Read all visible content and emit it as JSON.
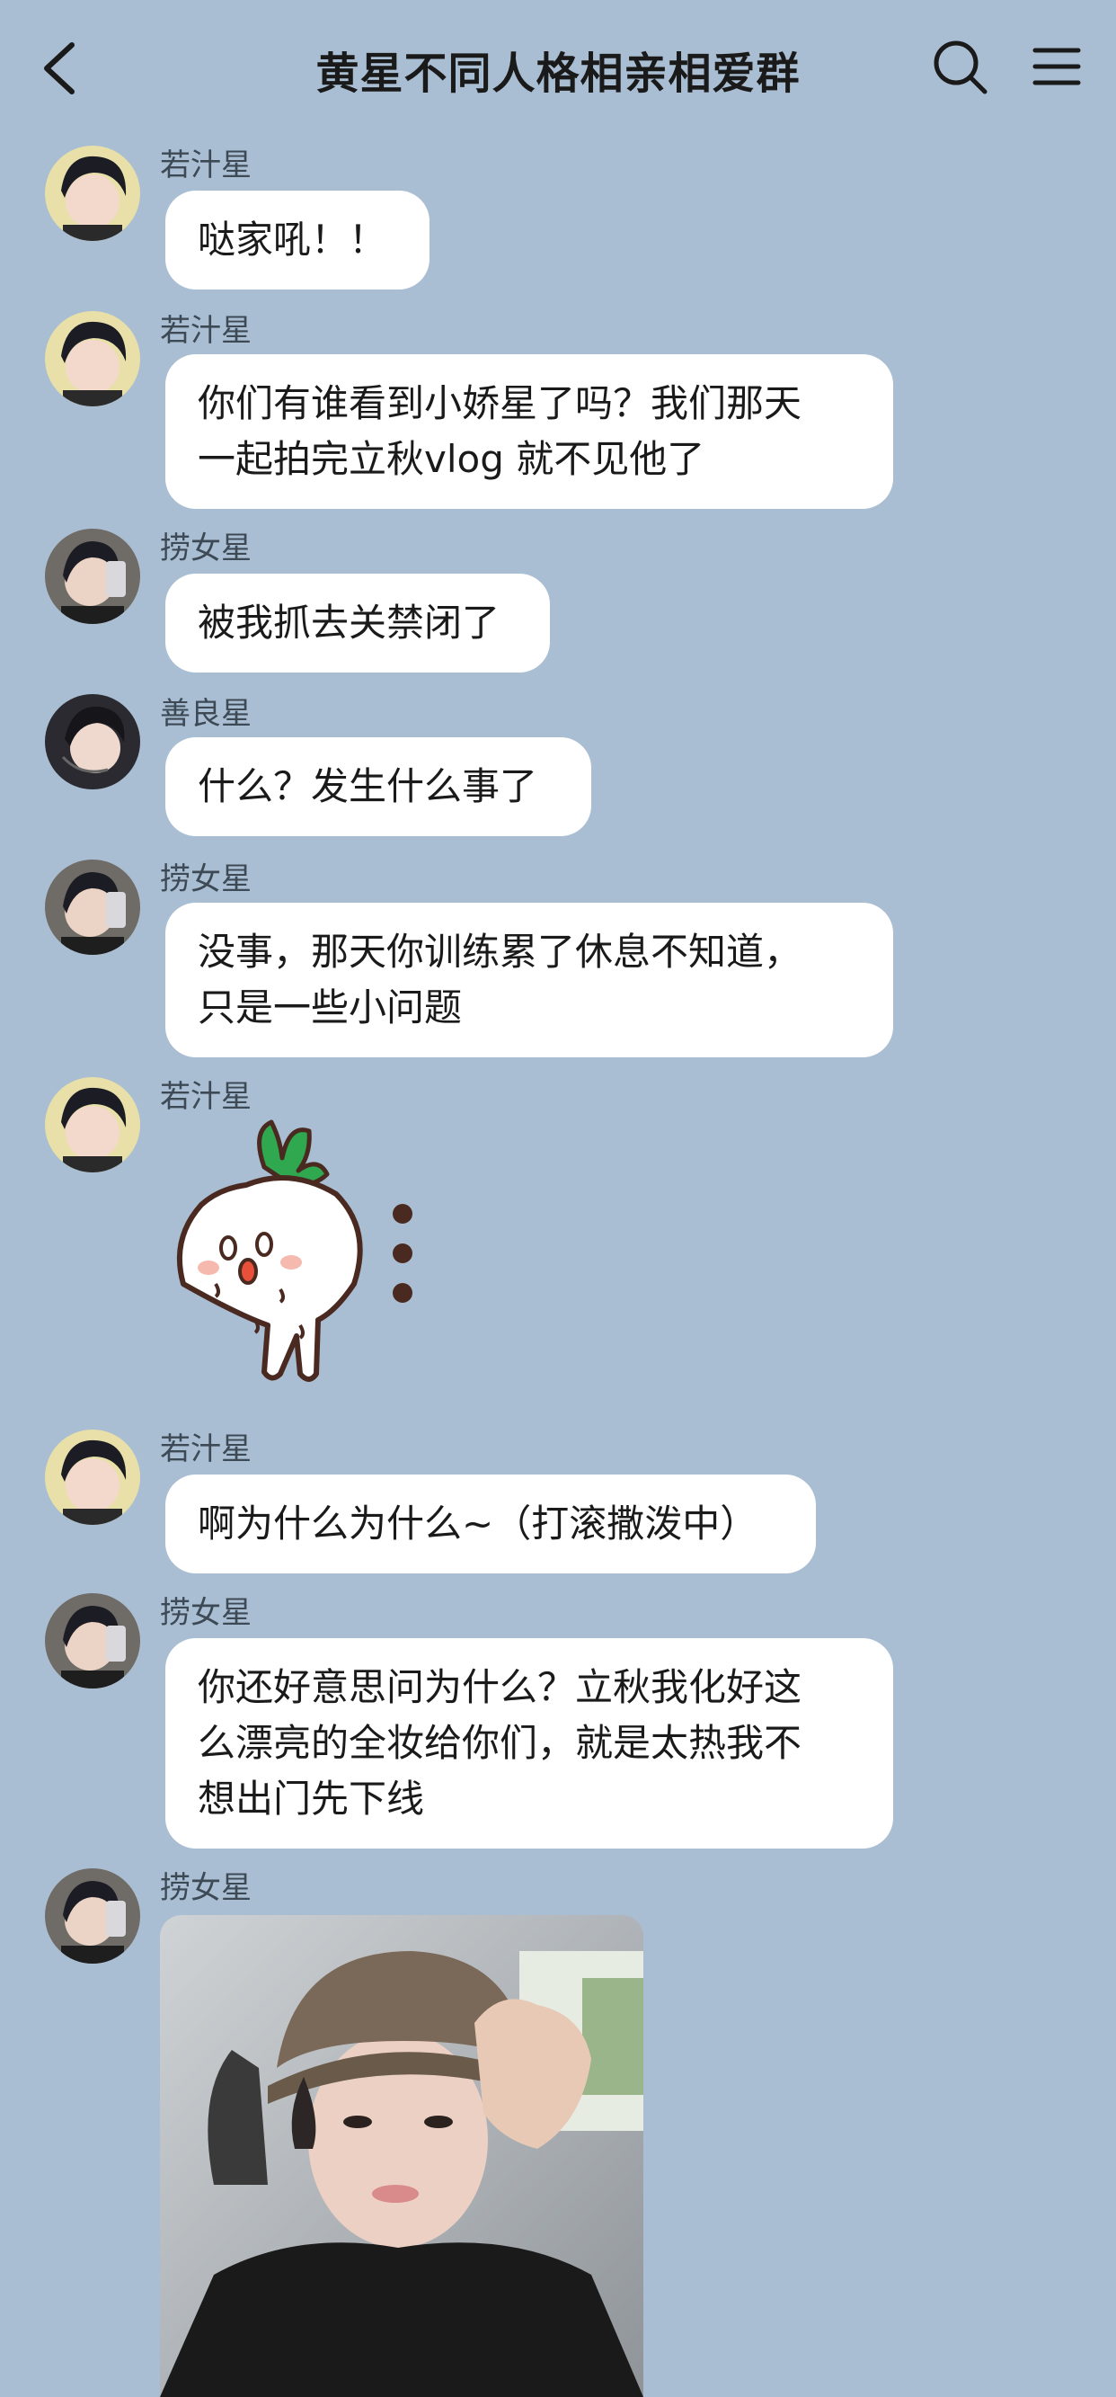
{
  "header": {
    "title": "黄星不同人格相亲相爱群",
    "back_icon": "chevron-left-icon",
    "search_icon": "search-icon",
    "menu_icon": "hamburger-menu-icon"
  },
  "messages": [
    {
      "sender": "若汁星",
      "lines": [
        "哒家吼！！"
      ]
    },
    {
      "sender": "若汁星",
      "lines": [
        "你们有谁看到小娇星了吗？我们那天",
        "一起拍完立秋vlog 就不见他了"
      ]
    },
    {
      "sender": "捞女星",
      "lines": [
        "被我抓去关禁闭了"
      ]
    },
    {
      "sender": "善良星",
      "lines": [
        "什么？发生什么事了"
      ]
    },
    {
      "sender": "捞女星",
      "lines": [
        "没事，那天你训练累了休息不知道，",
        "只是一些小问题"
      ]
    },
    {
      "sender": "若汁星",
      "sticker": "crying-radish-sticker"
    },
    {
      "sender": "若汁星",
      "lines": [
        "啊为什么为什么~（打滚撒泼中）"
      ]
    },
    {
      "sender": "捞女星",
      "lines": [
        "你还好意思问为什么？立秋我化好这",
        "么漂亮的全妆给你们，就是太热我不",
        "想出门先下线"
      ]
    },
    {
      "sender": "捞女星",
      "photo": "selfie-photo-in-car"
    }
  ],
  "colors": {
    "background": "#A9BED2",
    "bubble": "#FFFFFF",
    "sender_text": "#3D4A56",
    "radish_leaf": "#2FA84F"
  }
}
